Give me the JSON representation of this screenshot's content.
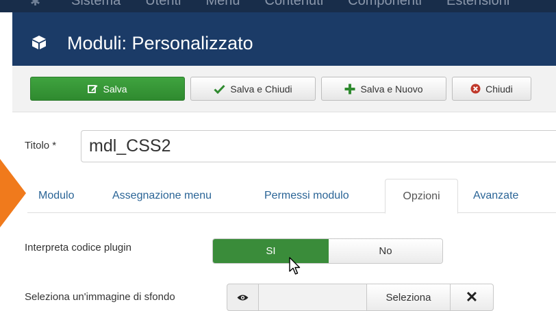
{
  "topnav": {
    "items": [
      "Sistema",
      "Utenti",
      "Menu",
      "Contenuti",
      "Componenti",
      "Estensioni"
    ]
  },
  "header": {
    "title": "Moduli: Personalizzato",
    "icon": "cube-icon"
  },
  "toolbar": {
    "save_label": "Salva",
    "save_close_label": "Salva e Chiudi",
    "save_new_label": "Salva e Nuovo",
    "close_label": "Chiudi"
  },
  "form": {
    "title_label": "Titolo *",
    "title_value": "mdl_CSS2"
  },
  "tabs": [
    "Modulo",
    "Assegnazione menu",
    "Permessi modulo",
    "Opzioni",
    "Avanzate"
  ],
  "active_tab": "Opzioni",
  "options": {
    "plugin_label": "Interpreta codice plugin",
    "toggle_yes": "SI",
    "toggle_no": "No",
    "toggle_selected": "SI",
    "bg_image_label": "Seleziona un'immagine di sfondo",
    "bg_image_select": "Seleziona"
  },
  "colors": {
    "header_bg": "#1b3b67",
    "save_green": "#2f8a2f",
    "tab_link": "#2a6496",
    "accent_orange": "#f07a1c"
  }
}
